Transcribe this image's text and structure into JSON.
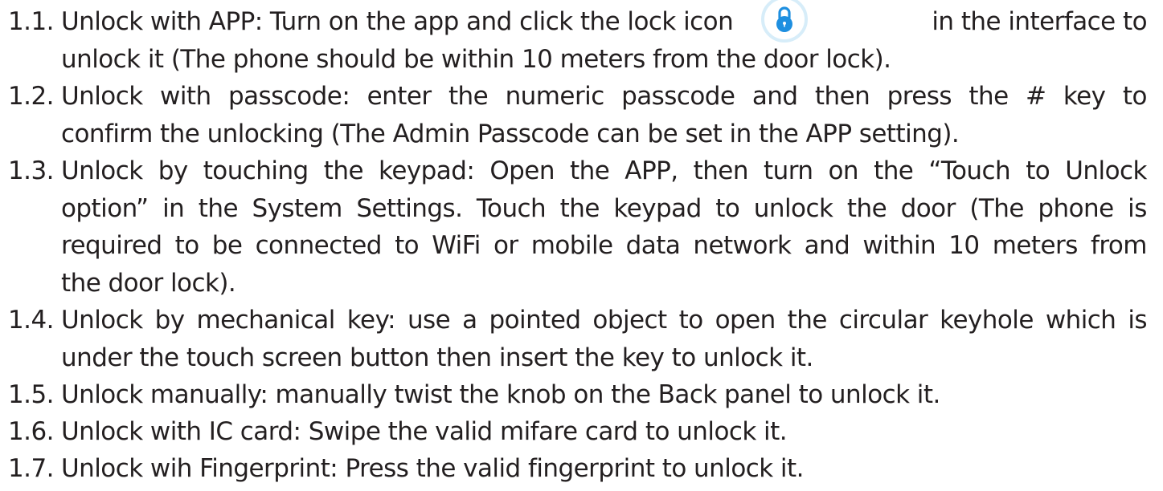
{
  "lock_icon": {
    "ring_color": "#d7edf9",
    "fill_color": "#1e8fe0"
  },
  "items": [
    {
      "number": "1.1.",
      "line1_before": "Unlock with APP: Turn on the app and click the lock icon",
      "line1_after": "in the interface to",
      "lines": [
        "unlock it (The phone should be within 10 meters from the door lock)."
      ]
    },
    {
      "number": "1.2.",
      "lines": [
        "Unlock with passcode: enter the numeric passcode and then press the # key to",
        "confirm the unlocking (The Admin Passcode can be set in the APP setting)."
      ]
    },
    {
      "number": "1.3.",
      "lines": [
        "Unlock by touching the keypad: Open the APP, then turn on the “Touch to Unlock",
        "option” in the System Settings. Touch the keypad to unlock the door (The phone is",
        "required to be connected to WiFi or mobile data network and within 10 meters from",
        "the door lock)."
      ]
    },
    {
      "number": "1.4.",
      "lines": [
        "Unlock by mechanical key: use a pointed object to open the circular keyhole which is",
        "under the touch screen button then insert the key to unlock it."
      ]
    },
    {
      "number": "1.5.",
      "lines": [
        "Unlock manually: manually twist the knob on the Back panel to unlock it."
      ]
    },
    {
      "number": "1.6.",
      "lines": [
        "Unlock with IC card: Swipe the valid mifare card to unlock it."
      ]
    },
    {
      "number": "1.7.",
      "lines": [
        "Unlock wih Fingerprint: Press the valid fingerprint to unlock it."
      ]
    }
  ]
}
